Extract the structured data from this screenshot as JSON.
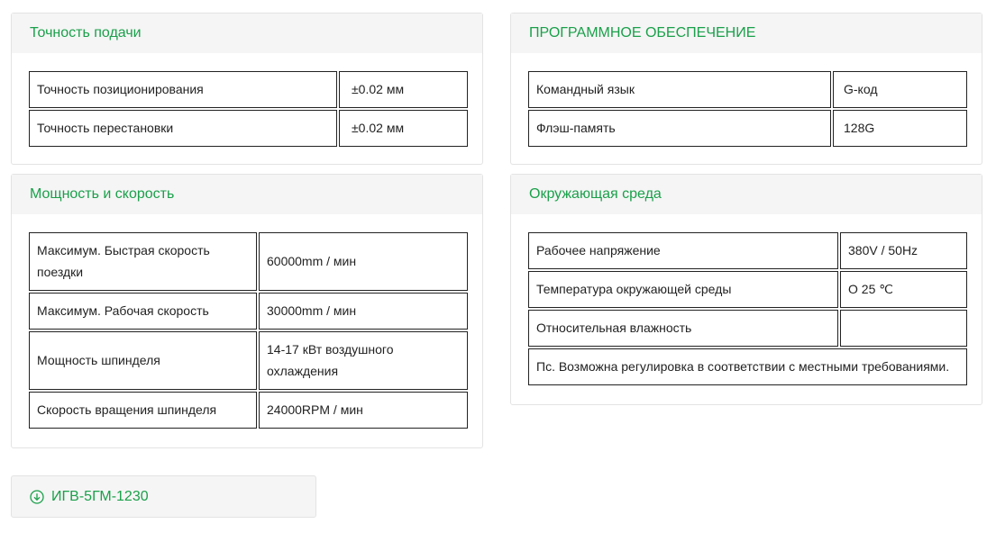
{
  "feed_accuracy": {
    "title": "Точность подачи",
    "rows": [
      {
        "label": "Точность позиционирования",
        "value": "±0.02 мм"
      },
      {
        "label": "Точность перестановки",
        "value": "±0.02 мм"
      }
    ]
  },
  "power_speed": {
    "title": "Мощность и скорость",
    "rows": [
      {
        "label": "Максимум. Быстрая скорость поездки",
        "value": "60000mm / мин"
      },
      {
        "label": "Максимум. Рабочая скорость",
        "value": "30000mm / мин"
      },
      {
        "label": "Мощность шпинделя",
        "value": "14-17 кВт воздушного охлаждения"
      },
      {
        "label": "Скорость вращения шпинделя",
        "value": "24000RPM / мин"
      }
    ]
  },
  "software": {
    "title": "ПРОГРАММНОЕ ОБЕСПЕЧЕНИЕ",
    "rows": [
      {
        "label": "Командный язык",
        "value": "G-код"
      },
      {
        "label": "Флэш-память",
        "value": "128G"
      }
    ]
  },
  "environment": {
    "title": "Окружающая среда",
    "rows": [
      {
        "label": "Рабочее напряжение",
        "value": "380V / 50Hz"
      },
      {
        "label": "Температура окружающей среды",
        "value": "O 25 ℃"
      },
      {
        "label": "Относительная влажность",
        "value": ""
      }
    ],
    "note": "Пс. Возможна регулировка в соответствии с местными требованиями."
  },
  "download": {
    "icon": "download-circle-icon",
    "label": "ИГВ-5ГМ-1230"
  },
  "colors": {
    "accent": "#1aa04a",
    "header_bg": "#f5f5f5",
    "border": "#e3e3e3"
  }
}
